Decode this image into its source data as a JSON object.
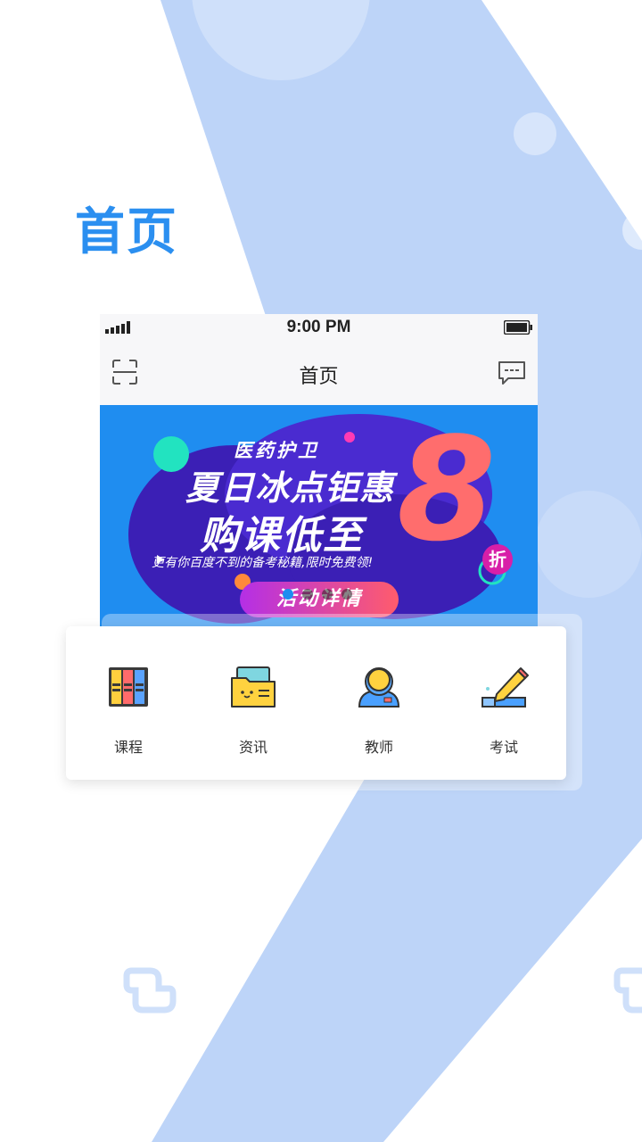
{
  "headline": "首页",
  "phone": {
    "status": {
      "time": "9:00 PM"
    },
    "nav": {
      "title": "首页"
    },
    "banner": {
      "subtitle": "医药护卫",
      "title_line1": "夏日冰点钜惠",
      "title_line2": "购课低至",
      "big_number": "8",
      "discount_unit": "折",
      "note": "更有你百度不到的备考秘籍,限时免费领!",
      "cta": "活动详情",
      "carousel": {
        "count": 4,
        "active_index": 0
      }
    }
  },
  "categories": [
    {
      "label": "课程",
      "icon": "books-icon"
    },
    {
      "label": "资讯",
      "icon": "folder-icon"
    },
    {
      "label": "教师",
      "icon": "teacher-icon"
    },
    {
      "label": "考试",
      "icon": "pencil-icon"
    }
  ],
  "colors": {
    "accent": "#2b8ff0",
    "background_stripe": "#bdd4f8",
    "banner_blue": "#1f8df0",
    "banner_purple": "#3b1fb5"
  }
}
